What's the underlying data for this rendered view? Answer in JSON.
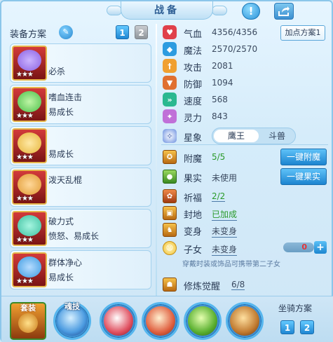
{
  "window": {
    "title": "战备"
  },
  "equipment": {
    "title": "装备方案",
    "tabs": [
      "1",
      "2"
    ],
    "cards": [
      {
        "name": "",
        "effect": "必杀",
        "stars": "★★★",
        "art_color": "#8a5fe0"
      },
      {
        "name": "嗜血连击",
        "effect": "易成长",
        "stars": "★★★",
        "art_color": "#4cc04a"
      },
      {
        "name": "",
        "effect": "易成长",
        "stars": "★★★",
        "art_color": "#e6b43a"
      },
      {
        "name": "泼天乱棍",
        "effect": "",
        "stars": "★★★",
        "art_color": "#e09a32"
      },
      {
        "name": "破力式",
        "effect": "愤怒、易成长",
        "stars": "★★★",
        "art_color": "#3cc0a0"
      },
      {
        "name": "群体净心",
        "effect": "易成长",
        "stars": "★★★",
        "art_color": "#3a9ae0"
      }
    ]
  },
  "stats": {
    "plan_button": "加点方案1",
    "rows": [
      {
        "label": "气血",
        "value": "4356/4356",
        "icon": "heart-icon",
        "color": "#e0404a"
      },
      {
        "label": "魔法",
        "value": "2570/2570",
        "icon": "mana-diamond-icon",
        "color": "#2d9ce0"
      },
      {
        "label": "攻击",
        "value": "2081",
        "icon": "sword-icon",
        "color": "#f0a030"
      },
      {
        "label": "防御",
        "value": "1094",
        "icon": "shield-icon",
        "color": "#e07030"
      },
      {
        "label": "速度",
        "value": "568",
        "icon": "speed-icon",
        "color": "#2ab890"
      },
      {
        "label": "灵力",
        "value": "843",
        "icon": "spirit-icon",
        "color": "#c070d8"
      }
    ],
    "star_sign": {
      "label": "星象",
      "selected": "鹰王",
      "other": "斗兽"
    }
  },
  "extras": [
    {
      "label": "附魔",
      "value": "5/5",
      "style": "green",
      "button": "一键附魔"
    },
    {
      "label": "果实",
      "value": "未使用",
      "style": "gray",
      "button": "一键果实"
    },
    {
      "label": "祈福",
      "value": "2/2",
      "style": "green underline",
      "button": ""
    },
    {
      "label": "封地",
      "value": "已加成",
      "style": "green underline",
      "button": ""
    },
    {
      "label": "变身",
      "value": "未变身",
      "style": "gray underline",
      "button": ""
    },
    {
      "label": "子女",
      "value": "未变身",
      "style": "gray underline",
      "button": ""
    }
  ],
  "child_counter": "0",
  "child_note": "穿戴时装或饰品可携带第二子女",
  "awaken": {
    "label": "修炼觉醒",
    "value": "6/8"
  },
  "skills": {
    "square_label": "套装",
    "items": [
      {
        "label": "魂技"
      },
      {
        "label": ""
      },
      {
        "label": ""
      },
      {
        "label": ""
      },
      {
        "label": ""
      }
    ]
  },
  "mount": {
    "title": "坐骑方案",
    "buttons": [
      "1",
      "2"
    ]
  }
}
